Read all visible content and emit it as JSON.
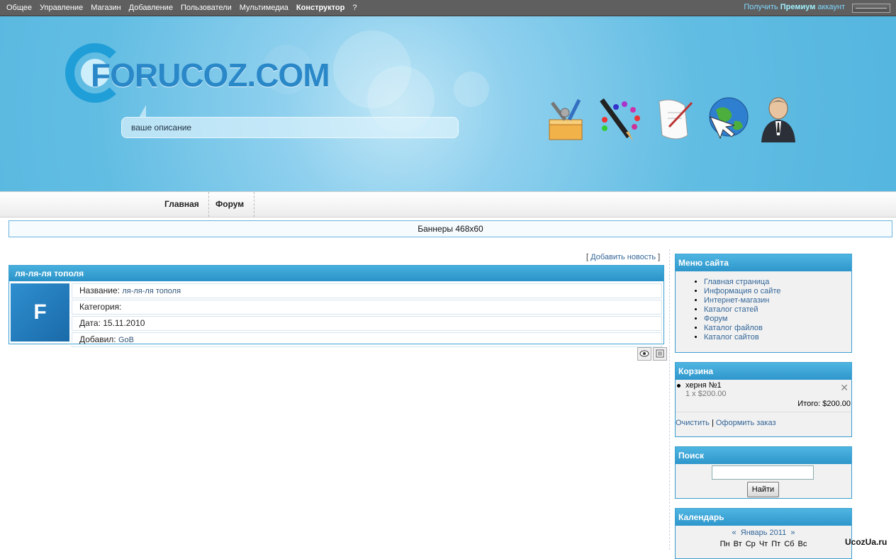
{
  "topbar": {
    "menu": [
      "Общее",
      "Управление",
      "Магазин",
      "Добавление",
      "Пользователи",
      "Мультимедиа",
      "Конструктор",
      "?"
    ],
    "premium_prefix": "Получить",
    "premium_bold": "Премиум",
    "premium_suffix": "аккаунт"
  },
  "header": {
    "logo_text": "FORUCOZ.COM",
    "description": "ваше описание",
    "icons": [
      "tools-box-icon",
      "palette-brush-icon",
      "scroll-quill-icon",
      "globe-cursor-icon",
      "user-suit-icon"
    ]
  },
  "nav": {
    "items": [
      "Главная",
      "Форум"
    ]
  },
  "banner": {
    "text": "Баннеры 468x60"
  },
  "content": {
    "add_news_open": "[",
    "add_news": "Добавить новость",
    "add_news_close": "]",
    "news": {
      "title": "ля-ля-ля тополя",
      "thumb_letter": "F",
      "name_label": "Название:",
      "name_value": "ля-ля-ля тополя",
      "category_label": "Категория:",
      "date_label": "Дата:",
      "date_value": "15.11.2010",
      "author_label": "Добавил:",
      "author_value": "GoB"
    }
  },
  "sidebar": {
    "menu": {
      "title": "Меню сайта",
      "items": [
        "Главная страница",
        "Информация о сайте",
        "Интернет-магазин",
        "Каталог статей",
        "Форум",
        "Каталог файлов",
        "Каталог сайтов"
      ]
    },
    "cart": {
      "title": "Корзина",
      "item_name": "херня №1",
      "item_qty": "1 x $200.00",
      "total": "Итого: $200.00",
      "clear": "Очистить",
      "divider": "|",
      "order": "Оформить заказ"
    },
    "search": {
      "title": "Поиск",
      "button": "Найти"
    },
    "calendar": {
      "title": "Календарь",
      "prev": "«",
      "month": "Январь 2011",
      "next": "»",
      "days": "Пн Вт Ср Чт Пт Сб Вс"
    }
  },
  "watermark": "UcozUa.ru"
}
